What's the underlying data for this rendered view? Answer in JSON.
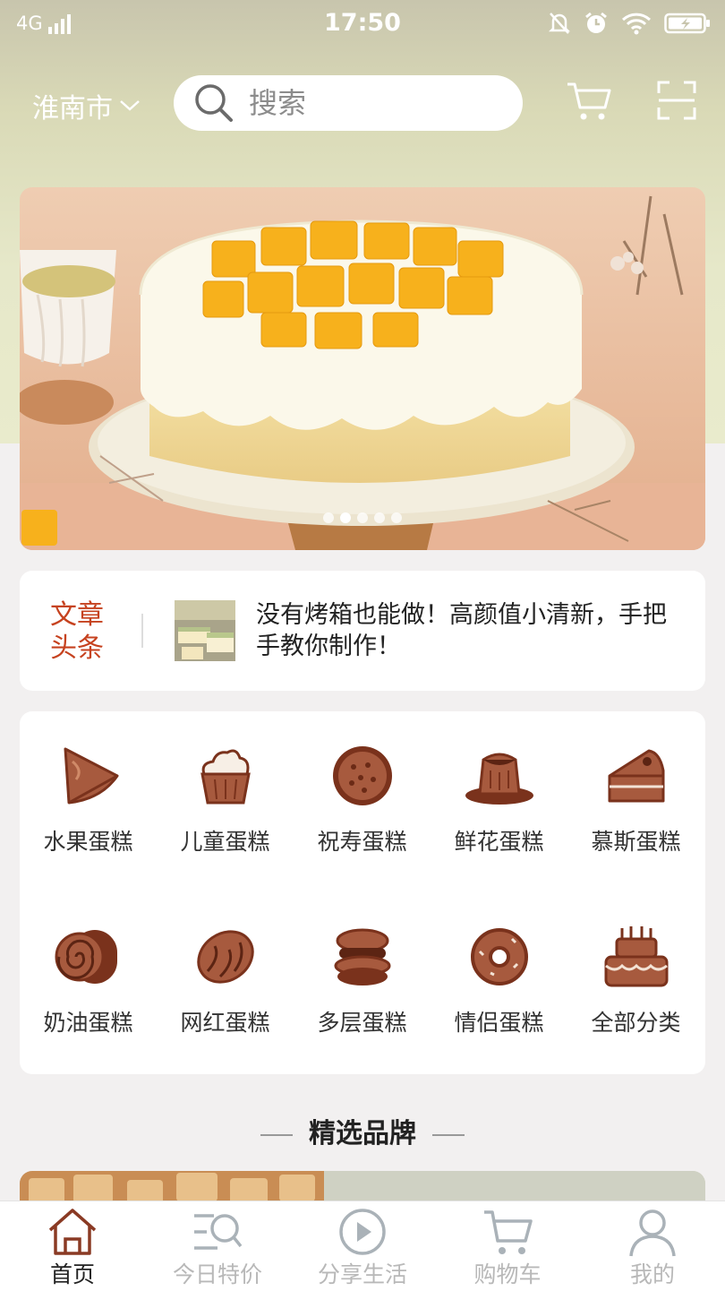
{
  "status_bar": {
    "network": "4G",
    "time": "17:50"
  },
  "header": {
    "city": "淮南市",
    "search_placeholder": "搜索"
  },
  "banner": {
    "slide_count": 5,
    "active_index": 1
  },
  "news": {
    "tag": "文章头条",
    "text": "没有烤箱也能做！高颜值小清新，手把手教你制作！"
  },
  "categories": [
    {
      "label": "水果蛋糕",
      "icon": "fruit-cake-slice-icon"
    },
    {
      "label": "儿童蛋糕",
      "icon": "cupcake-icon"
    },
    {
      "label": "祝寿蛋糕",
      "icon": "cookie-icon"
    },
    {
      "label": "鲜花蛋糕",
      "icon": "pudding-icon"
    },
    {
      "label": "慕斯蛋糕",
      "icon": "mousse-cake-slice-icon"
    },
    {
      "label": "奶油蛋糕",
      "icon": "swiss-roll-icon"
    },
    {
      "label": "网红蛋糕",
      "icon": "bread-icon"
    },
    {
      "label": "多层蛋糕",
      "icon": "macaron-icon"
    },
    {
      "label": "情侣蛋糕",
      "icon": "donut-icon"
    },
    {
      "label": "全部分类",
      "icon": "birthday-cake-icon"
    }
  ],
  "section": {
    "title": "精选品牌"
  },
  "tabs": [
    {
      "label": "首页",
      "icon": "home-icon",
      "active": true
    },
    {
      "label": "今日特价",
      "icon": "search-list-icon",
      "active": false
    },
    {
      "label": "分享生活",
      "icon": "play-circle-icon",
      "active": false
    },
    {
      "label": "购物车",
      "icon": "cart-icon",
      "active": false
    },
    {
      "label": "我的",
      "icon": "user-icon",
      "active": false
    }
  ],
  "colors": {
    "accent": "#c6421f",
    "icon_brown": "#8a3a24",
    "tab_active": "#8a3a24",
    "tab_inactive": "#b8b8b8"
  }
}
